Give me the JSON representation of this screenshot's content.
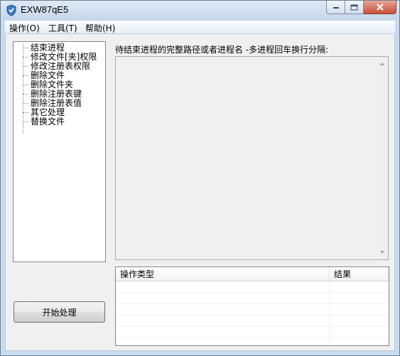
{
  "window": {
    "title": "EXW87qE5",
    "icon": "shield-icon"
  },
  "menu": [
    "操作(O)",
    "工具(T)",
    "帮助(H)"
  ],
  "tree": {
    "items": [
      "结束进程",
      "修改文件[夹]权限",
      "修改注册表权限",
      "删除文件",
      "删除文件夹",
      "删除注册表键",
      "删除注册表值",
      "其它处理",
      "替换文件"
    ]
  },
  "main": {
    "hint": "待结束进程的完整路径或者进程名 -多进程回车换行分隔:",
    "input_value": ""
  },
  "results": {
    "columns": [
      "操作类型",
      "结果"
    ],
    "rows": []
  },
  "buttons": {
    "start": "开始处理"
  }
}
